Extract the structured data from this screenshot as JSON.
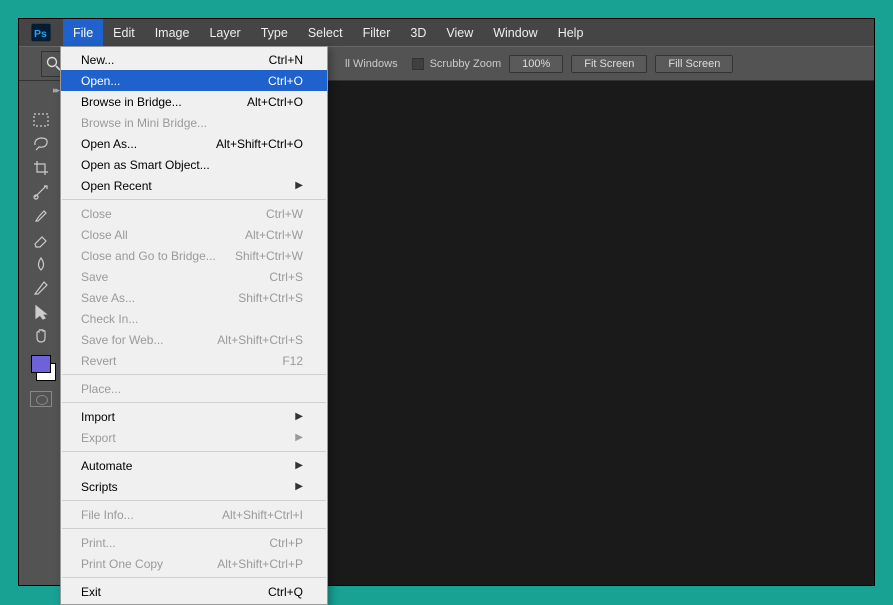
{
  "menubar": [
    "File",
    "Edit",
    "Image",
    "Layer",
    "Type",
    "Select",
    "Filter",
    "3D",
    "View",
    "Window",
    "Help"
  ],
  "menubar_active": 0,
  "optionbar": {
    "windows_label": "ll Windows",
    "scrubby": "Scrubby Zoom",
    "zoom_pct": "100%",
    "fit": "Fit Screen",
    "fill": "Fill Screen"
  },
  "dropdown": [
    {
      "label": "New...",
      "shortcut": "Ctrl+N"
    },
    {
      "label": "Open...",
      "shortcut": "Ctrl+O",
      "highlight": true
    },
    {
      "label": "Browse in Bridge...",
      "shortcut": "Alt+Ctrl+O"
    },
    {
      "label": "Browse in Mini Bridge...",
      "disabled": true
    },
    {
      "label": "Open As...",
      "shortcut": "Alt+Shift+Ctrl+O"
    },
    {
      "label": "Open as Smart Object..."
    },
    {
      "label": "Open Recent",
      "sub": true
    },
    {
      "sep": true
    },
    {
      "label": "Close",
      "shortcut": "Ctrl+W",
      "disabled": true
    },
    {
      "label": "Close All",
      "shortcut": "Alt+Ctrl+W",
      "disabled": true
    },
    {
      "label": "Close and Go to Bridge...",
      "shortcut": "Shift+Ctrl+W",
      "disabled": true
    },
    {
      "label": "Save",
      "shortcut": "Ctrl+S",
      "disabled": true
    },
    {
      "label": "Save As...",
      "shortcut": "Shift+Ctrl+S",
      "disabled": true
    },
    {
      "label": "Check In...",
      "disabled": true
    },
    {
      "label": "Save for Web...",
      "shortcut": "Alt+Shift+Ctrl+S",
      "disabled": true
    },
    {
      "label": "Revert",
      "shortcut": "F12",
      "disabled": true
    },
    {
      "sep": true
    },
    {
      "label": "Place...",
      "disabled": true
    },
    {
      "sep": true
    },
    {
      "label": "Import",
      "sub": true
    },
    {
      "label": "Export",
      "sub": true,
      "disabled": true
    },
    {
      "sep": true
    },
    {
      "label": "Automate",
      "sub": true
    },
    {
      "label": "Scripts",
      "sub": true
    },
    {
      "sep": true
    },
    {
      "label": "File Info...",
      "shortcut": "Alt+Shift+Ctrl+I",
      "disabled": true
    },
    {
      "sep": true
    },
    {
      "label": "Print...",
      "shortcut": "Ctrl+P",
      "disabled": true
    },
    {
      "label": "Print One Copy",
      "shortcut": "Alt+Shift+Ctrl+P",
      "disabled": true
    },
    {
      "sep": true
    },
    {
      "label": "Exit",
      "shortcut": "Ctrl+Q"
    }
  ],
  "tool_names": [
    "marquee",
    "lasso",
    "crop",
    "healing-brush",
    "brush",
    "eraser",
    "blur",
    "pen",
    "path-select",
    "hand"
  ]
}
